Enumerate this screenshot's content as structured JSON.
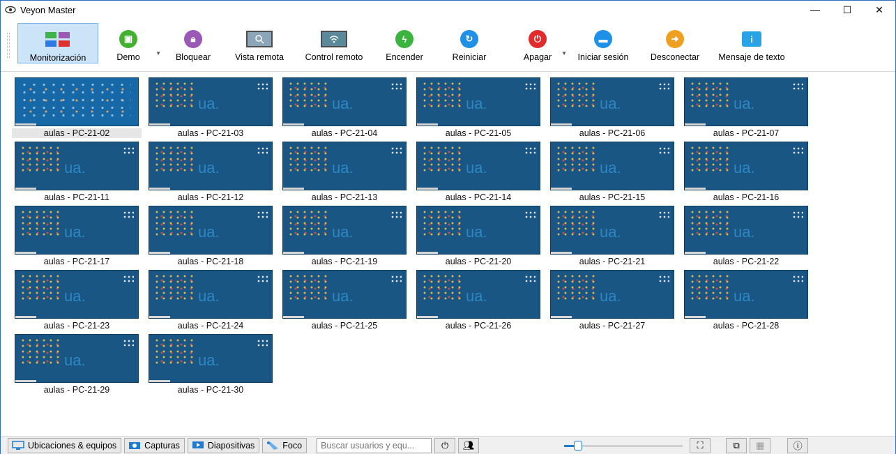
{
  "window": {
    "title": "Veyon Master",
    "controls": [
      "—",
      "☐",
      "✕"
    ]
  },
  "toolbar": {
    "buttons": [
      {
        "label": "Monitorización",
        "icon": "monitoring-icon",
        "active": true
      },
      {
        "label": "Demo",
        "icon": "demo-icon",
        "color": "#43b12f",
        "dropdown": true
      },
      {
        "label": "Bloquear",
        "icon": "lock-icon",
        "color": "#9b59b6"
      },
      {
        "label": "Vista remota",
        "icon": "remote-view-icon"
      },
      {
        "label": "Control remoto",
        "icon": "remote-control-icon"
      },
      {
        "label": "Encender",
        "icon": "power-on-icon",
        "color": "#3bb33f"
      },
      {
        "label": "Reiniciar",
        "icon": "reboot-icon",
        "color": "#1e90e6"
      },
      {
        "label": "Apagar",
        "icon": "power-off-icon",
        "color": "#e02c2c",
        "dropdown": true
      },
      {
        "label": "Iniciar sesión",
        "icon": "login-icon",
        "color": "#1e90e6"
      },
      {
        "label": "Desconectar",
        "icon": "logout-icon",
        "color": "#f0a020"
      },
      {
        "label": "Mensaje de texto",
        "icon": "text-message-icon",
        "color": "#2aa3e6"
      }
    ]
  },
  "computers": [
    "aulas - PC-21-02",
    "aulas - PC-21-03",
    "aulas - PC-21-04",
    "aulas - PC-21-05",
    "aulas - PC-21-06",
    "aulas - PC-21-07",
    "aulas - PC-21-11",
    "aulas - PC-21-12",
    "aulas - PC-21-13",
    "aulas - PC-21-14",
    "aulas - PC-21-15",
    "aulas - PC-21-16",
    "aulas - PC-21-17",
    "aulas - PC-21-18",
    "aulas - PC-21-19",
    "aulas - PC-21-20",
    "aulas - PC-21-21",
    "aulas - PC-21-22",
    "aulas - PC-21-23",
    "aulas - PC-21-24",
    "aulas - PC-21-25",
    "aulas - PC-21-26",
    "aulas - PC-21-27",
    "aulas - PC-21-28",
    "aulas - PC-21-29",
    "aulas - PC-21-30"
  ],
  "thumbnail_watermark": "ua.",
  "statusbar": {
    "tabs": [
      {
        "label": "Ubicaciones & equipos",
        "icon": "locations-icon"
      },
      {
        "label": "Capturas",
        "icon": "screenshots-icon"
      },
      {
        "label": "Diapositivas",
        "icon": "slideshow-icon"
      },
      {
        "label": "Foco",
        "icon": "spotlight-icon"
      }
    ],
    "search_placeholder": "Buscar usuarios y equ...",
    "zoom_level": 0.12,
    "colors": {
      "accent": "#1e7bd2"
    }
  }
}
